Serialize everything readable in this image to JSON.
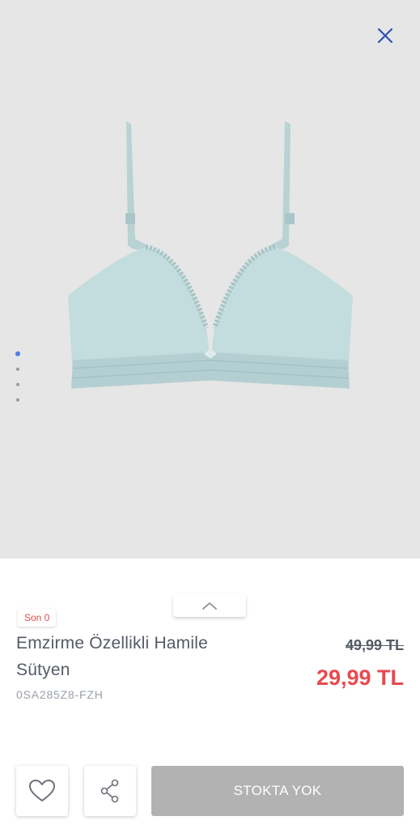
{
  "gallery": {
    "background": "#e6e6e6",
    "close_icon": "close-icon",
    "slide_count": 4,
    "active_slide": 1
  },
  "product": {
    "badge": "Son 0",
    "title_line1": "Emzirme Özellikli Hamile",
    "title_line2": "Sütyen",
    "sku": "0SA285Z8-FZH",
    "old_price": "49,99 TL",
    "new_price": "29,99 TL"
  },
  "actions": {
    "favorite_icon": "heart-icon",
    "share_icon": "share-icon",
    "cta_label": "STOKTA YOK"
  },
  "colors": {
    "accent_blue": "#2f4fb0",
    "price_red": "#e8494f",
    "disabled_gray": "#b2b2b2"
  }
}
